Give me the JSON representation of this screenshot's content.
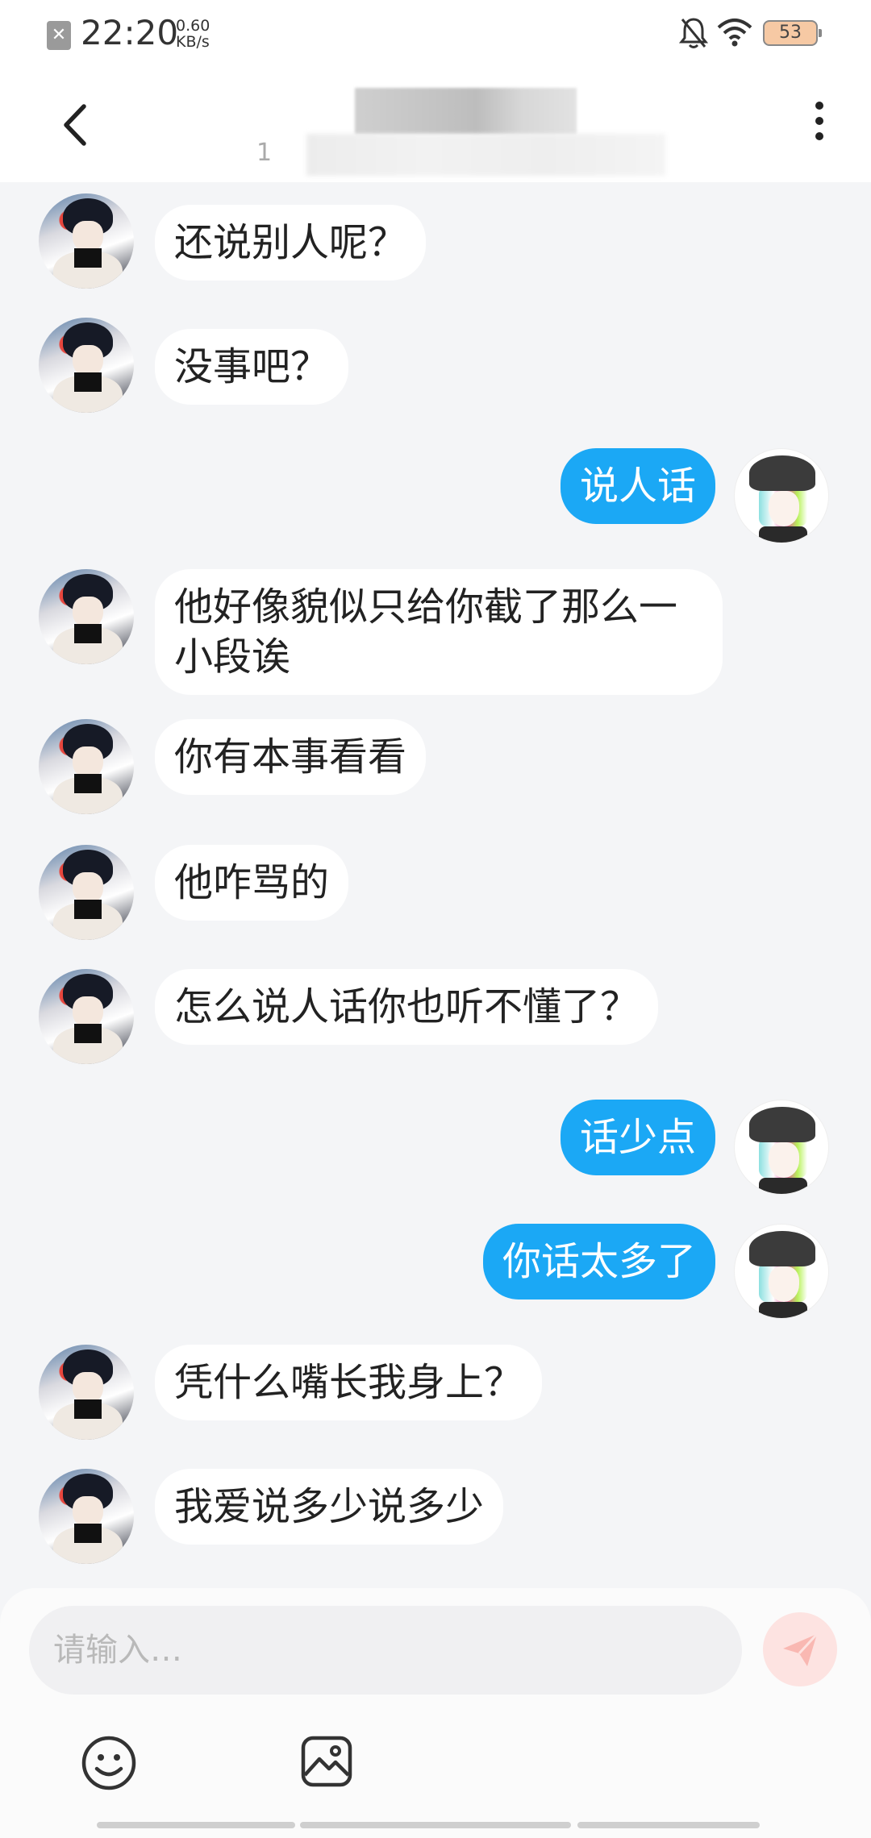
{
  "status_bar": {
    "time": "22:20",
    "speed_value": "0.60",
    "speed_unit": "KB/s",
    "battery": "53",
    "icons": [
      "sim-off-icon",
      "bell-muted-icon",
      "wifi-icon",
      "battery-icon"
    ]
  },
  "header": {
    "subtitle_prefix": "1",
    "icons": [
      "back-icon",
      "more-icon"
    ]
  },
  "messages": [
    {
      "from": "other",
      "text": "还说别人呢？"
    },
    {
      "from": "other",
      "text": "没事吧？"
    },
    {
      "from": "me",
      "text": "说人话"
    },
    {
      "from": "other",
      "text": "他好像貌似只给你截了那么一小段诶"
    },
    {
      "from": "other",
      "text": "你有本事看看"
    },
    {
      "from": "other",
      "text": "他咋骂的"
    },
    {
      "from": "other",
      "text": "怎么说人话你也听不懂了？"
    },
    {
      "from": "me",
      "text": "话少点"
    },
    {
      "from": "me",
      "text": "你话太多了"
    },
    {
      "from": "other",
      "text": "凭什么嘴长我身上？"
    },
    {
      "from": "other",
      "text": "我爱说多少说多少"
    }
  ],
  "composer": {
    "value": "",
    "placeholder": "请输入…",
    "send_icon": "send-icon",
    "tools": [
      "emoji-icon",
      "image-icon"
    ]
  },
  "colors": {
    "outgoing_bubble": "#1ba8f5",
    "incoming_bubble": "#ffffff",
    "background": "#f4f5f7",
    "send_button": "#fde3e1"
  }
}
